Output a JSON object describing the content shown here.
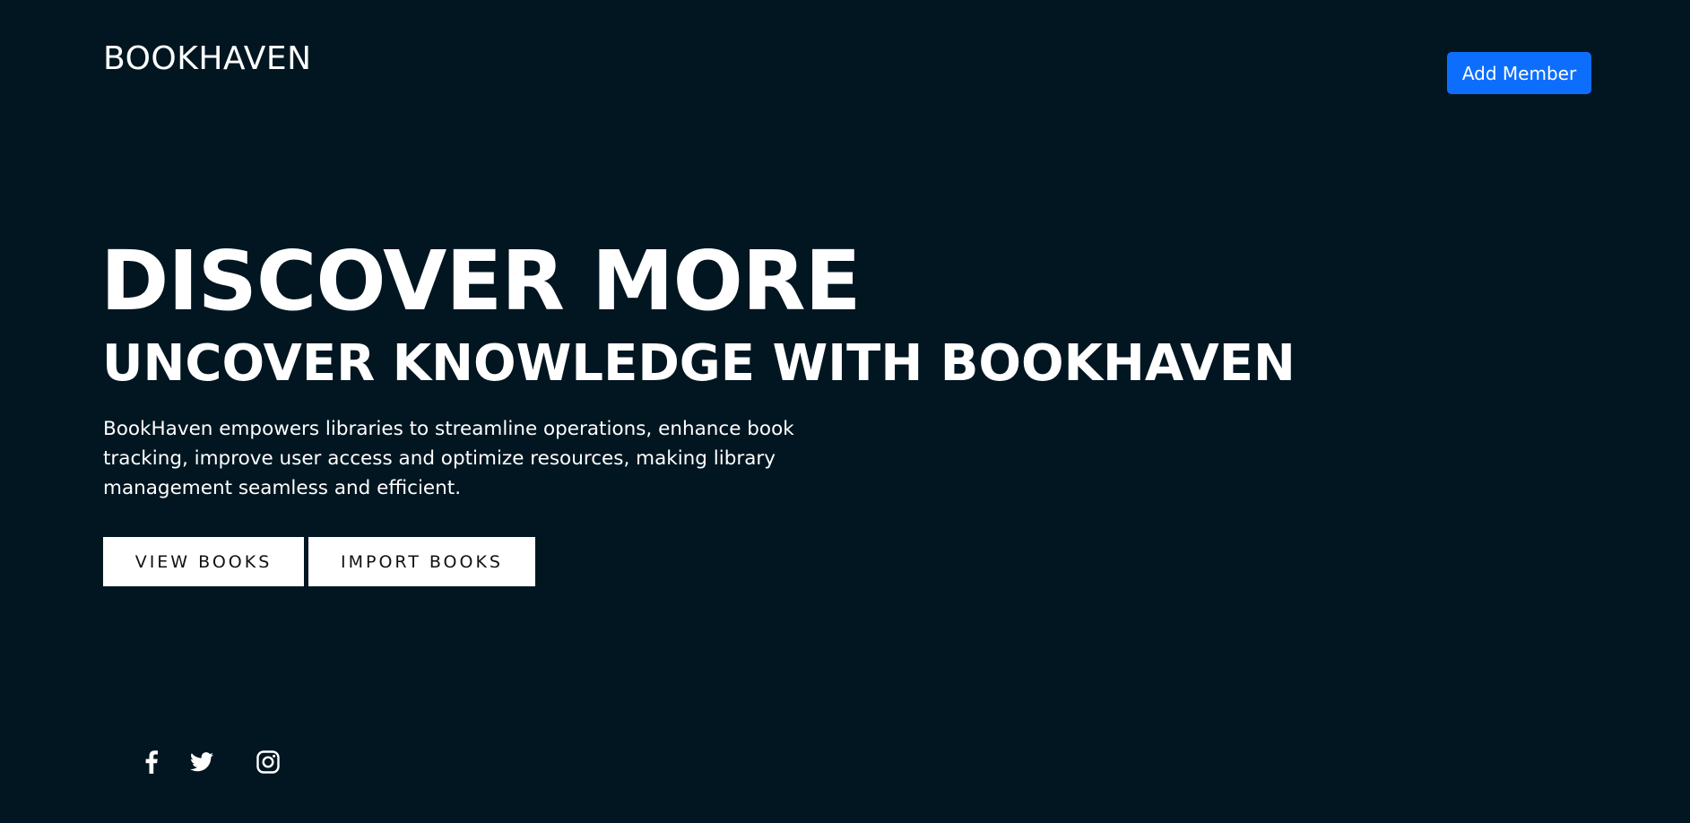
{
  "header": {
    "brand": "BOOKHAVEN",
    "add_member_label": "Add Member"
  },
  "hero": {
    "title": "DISCOVER MORE",
    "subtitle": "UNCOVER KNOWLEDGE WITH BOOKHAVEN",
    "description": "BookHaven empowers libraries to streamline operations, enhance book tracking, improve user access and optimize resources, making library management seamless and efficient.",
    "buttons": {
      "view_books": "VIEW BOOKS",
      "import_books": "IMPORT BOOKS"
    }
  },
  "social": {
    "icons": [
      "facebook-icon",
      "twitter-icon",
      "instagram-icon"
    ]
  },
  "colors": {
    "background": "#011621",
    "accent": "#0d6efd",
    "text": "#ffffff"
  }
}
